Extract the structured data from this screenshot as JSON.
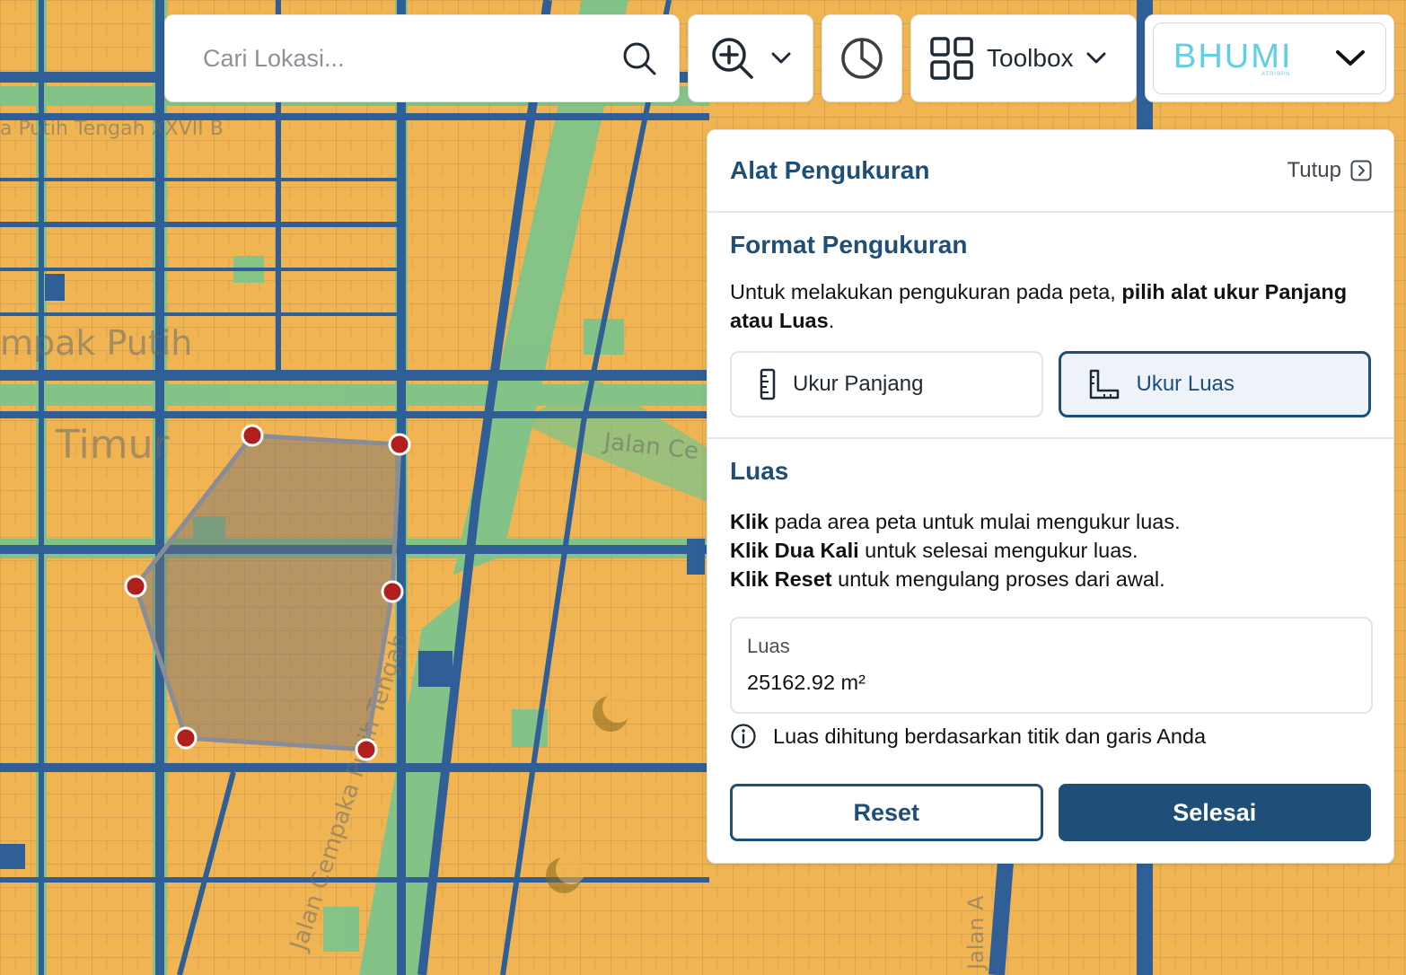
{
  "search": {
    "placeholder": "Cari Lokasi..."
  },
  "toolbar": {
    "zoom_icon": "zoom-in-icon",
    "stats_icon": "pie-chart-icon",
    "toolbox_label": "Toolbox",
    "brand_name": "BHUMI",
    "brand_sub": "ATR/BPN"
  },
  "map": {
    "street_labels": [
      "Jalan Cempaka Putih Tengah",
      "Jalan Ce",
      "Timur",
      "mpak Putih",
      "a Putih Tengah XXVII B",
      "Jalan A"
    ]
  },
  "panel": {
    "title": "Alat Pengukuran",
    "close_label": "Tutup",
    "format": {
      "title": "Format Pengukuran",
      "desc_start": "Untuk melakukan pengukuran pada peta, ",
      "desc_bold": "pilih alat ukur Panjang atau Luas",
      "desc_end": ".",
      "tabs": [
        {
          "label": "Ukur Panjang",
          "icon": "ruler-icon",
          "active": false
        },
        {
          "label": "Ukur Luas",
          "icon": "area-ruler-icon",
          "active": true
        }
      ]
    },
    "luas": {
      "title": "Luas",
      "instructions": [
        {
          "bold": "Klik",
          "text": " pada area peta untuk mulai mengukur luas."
        },
        {
          "bold": "Klik Dua Kali",
          "text": " untuk selesai mengukur luas."
        },
        {
          "bold": "Klik Reset",
          "text": " untuk mengulang proses dari awal."
        }
      ],
      "result_label": "Luas",
      "result_value": "25162.92 m²",
      "info_text": "Luas dihitung berdasarkan titik dan garis Anda",
      "reset_label": "Reset",
      "done_label": "Selesai"
    }
  },
  "colors": {
    "primary": "#1f4e79",
    "map_parcel": "#f0b552",
    "map_road": "#2f5f96",
    "map_green": "#7fc48a",
    "vertex": "#b01e1e"
  }
}
